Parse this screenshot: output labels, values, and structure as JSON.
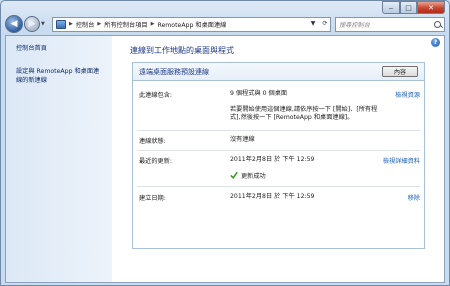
{
  "window": {
    "breadcrumbs": [
      "控制台",
      "所有控制台項目",
      "RemoteApp 和桌面連線"
    ],
    "search_placeholder": "搜尋控制台"
  },
  "sidebar": {
    "items": [
      {
        "label": "控制台首頁"
      },
      {
        "label": "設定與 RemoteApp 和桌面連線的新連線"
      }
    ]
  },
  "main": {
    "title": "連線到工作地點的桌面與程式",
    "panel": {
      "title": "遠端桌面服務預設連線",
      "properties_label": "內容",
      "contains": {
        "label": "此連線包含:",
        "value": "9 個程式與 0 個桌面",
        "note": "若要開始使用這個連線,請依序按一下 [開始]、[所有程式],然後按一下 [RemoteApp 和桌面連線]。",
        "link": "檢視資源"
      },
      "status": {
        "label": "連線狀態:",
        "value": "沒有連線"
      },
      "last_update": {
        "label": "最近的更新:",
        "value": "2011年2月8日 於 下午 12:59",
        "result": "更新成功",
        "link": "檢視詳細資料"
      },
      "created": {
        "label": "建立日期:",
        "value": "2011年2月8日 於 下午 12:59",
        "link": "移除"
      }
    }
  },
  "colors": {
    "accent_title": "#1e3a8a",
    "link": "#1a5fb4",
    "success": "#3b9b2a"
  }
}
